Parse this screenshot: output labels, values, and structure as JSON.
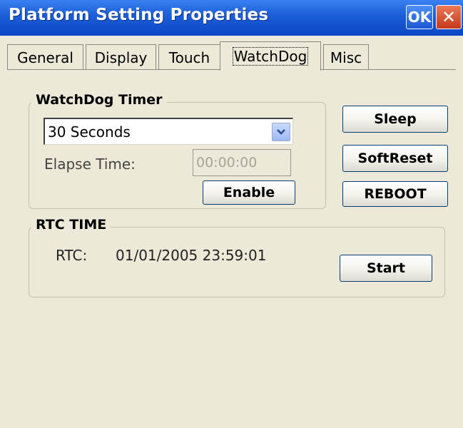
{
  "window": {
    "title": "Platform Setting Properties",
    "ok_label": "OK",
    "close_glyph": "✕"
  },
  "tabs": [
    {
      "label": "General",
      "active": false
    },
    {
      "label": "Display",
      "active": false
    },
    {
      "label": "Touch",
      "active": false
    },
    {
      "label": "WatchDog",
      "active": true
    },
    {
      "label": "Misc",
      "active": false
    }
  ],
  "watchdog": {
    "group_title": "WatchDog Timer",
    "timer_selected": "30 Seconds",
    "elapse_label": "Elapse Time:",
    "elapse_value": "00:00:00",
    "enable_label": "Enable"
  },
  "side_buttons": {
    "sleep_label": "Sleep",
    "softreset_label": "SoftReset",
    "reboot_label": "REBOOT"
  },
  "rtc": {
    "group_title": "RTC TIME",
    "label": "RTC:",
    "value": "01/01/2005 23:59:01",
    "start_label": "Start"
  },
  "icons": {
    "dropdown": "chevron-down-icon",
    "close": "close-icon"
  },
  "colors": {
    "titlebar": "#0a47c6",
    "window_bg": "#ece9d8",
    "close_button": "#c5371a",
    "button_border": "#003c74"
  }
}
